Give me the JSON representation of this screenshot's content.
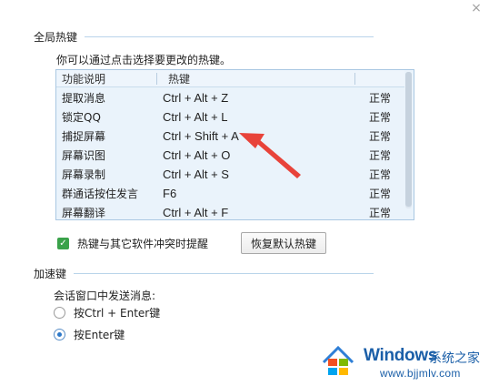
{
  "window": {
    "close_glyph": "×"
  },
  "global_hotkeys": {
    "title": "全局热键",
    "description": "你可以通过点击选择要更改的热键。",
    "columns": {
      "function": "功能说明",
      "hotkey": "热键"
    },
    "rows": [
      {
        "function": "提取消息",
        "hotkey": "Ctrl + Alt + Z",
        "status": "正常"
      },
      {
        "function": "锁定QQ",
        "hotkey": "Ctrl + Alt + L",
        "status": "正常"
      },
      {
        "function": "捕捉屏幕",
        "hotkey": "Ctrl + Shift + A",
        "status": "正常"
      },
      {
        "function": "屏幕识图",
        "hotkey": "Ctrl + Alt + O",
        "status": "正常"
      },
      {
        "function": "屏幕录制",
        "hotkey": "Ctrl + Alt + S",
        "status": "正常"
      },
      {
        "function": "群通话按住发言",
        "hotkey": "F6",
        "status": "正常"
      },
      {
        "function": "屏幕翻译",
        "hotkey": "Ctrl + Alt + F",
        "status": "正常"
      }
    ],
    "conflict_checkbox": {
      "label": "热键与其它软件冲突时提醒",
      "checked": true,
      "check_glyph": "✓"
    },
    "restore_button": "恢复默认热键"
  },
  "accelerator": {
    "title": "加速键",
    "send_label": "会话窗口中发送消息:",
    "options": [
      {
        "label": "按Ctrl + Enter键",
        "selected": false
      },
      {
        "label": "按Enter键",
        "selected": true
      }
    ]
  },
  "colors": {
    "accent_red": "#e8433a",
    "table_bg": "#eaf3fb",
    "checkbox_green": "#3aa24a",
    "brand_blue": "#1b5fa8"
  },
  "watermark": {
    "brand": "Windows",
    "chinese": "系统之家",
    "url": "www.bjjmlv.com"
  }
}
